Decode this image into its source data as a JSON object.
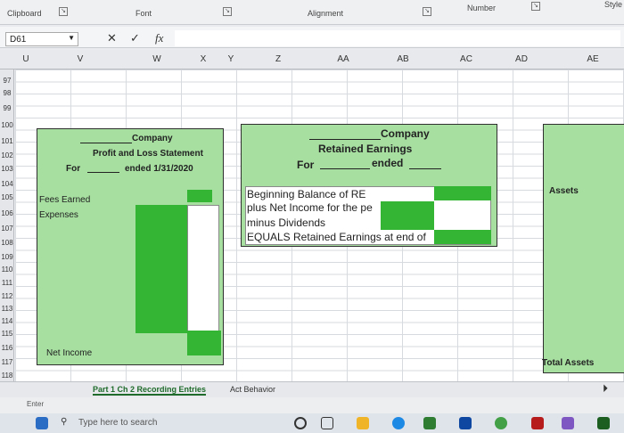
{
  "ribbon": {
    "clipboard": "Clipboard",
    "font": "Font",
    "alignment": "Alignment",
    "number": "Number",
    "styles": "Style"
  },
  "formula_bar": {
    "name_box": "D61",
    "cancel": "✕",
    "enter": "✓",
    "fx": "fx"
  },
  "columns": [
    "U",
    "V",
    "W",
    "X",
    "Y",
    "Z",
    "AA",
    "AB",
    "AC",
    "AD",
    "AE"
  ],
  "rows": [
    "97",
    "98",
    "99",
    "100",
    "101",
    "102",
    "103",
    "104",
    "105",
    "106",
    "107",
    "108",
    "109",
    "110",
    "111",
    "112",
    "113",
    "114",
    "115",
    "116",
    "117",
    "118"
  ],
  "pl": {
    "company": "Company",
    "title": "Profit and Loss Statement",
    "for": "For",
    "ended": "ended 1/31/2020",
    "fees_earned": "Fees Earned",
    "expenses": "Expenses",
    "net_income": "Net Income"
  },
  "re": {
    "company": "Company",
    "title": "Retained Earnings",
    "for": "For",
    "ended": "ended",
    "beginning": "Beginning Balance of RE",
    "plus_net": "plus Net Income for the pe",
    "minus_div": "minus Dividends",
    "equals": "EQUALS Retained Earnings at end of"
  },
  "bs": {
    "assets": "Assets",
    "total_assets": "Total Assets"
  },
  "sheet_tabs": [
    "Part 1 Ch 2 Recording Entries",
    "Act Behavior"
  ],
  "status": {
    "mode": "Enter"
  },
  "taskbar": {
    "search_placeholder": "Type here to search"
  },
  "colors": {
    "block_fill": "#a6dfa0",
    "input_green": "#34b534"
  }
}
